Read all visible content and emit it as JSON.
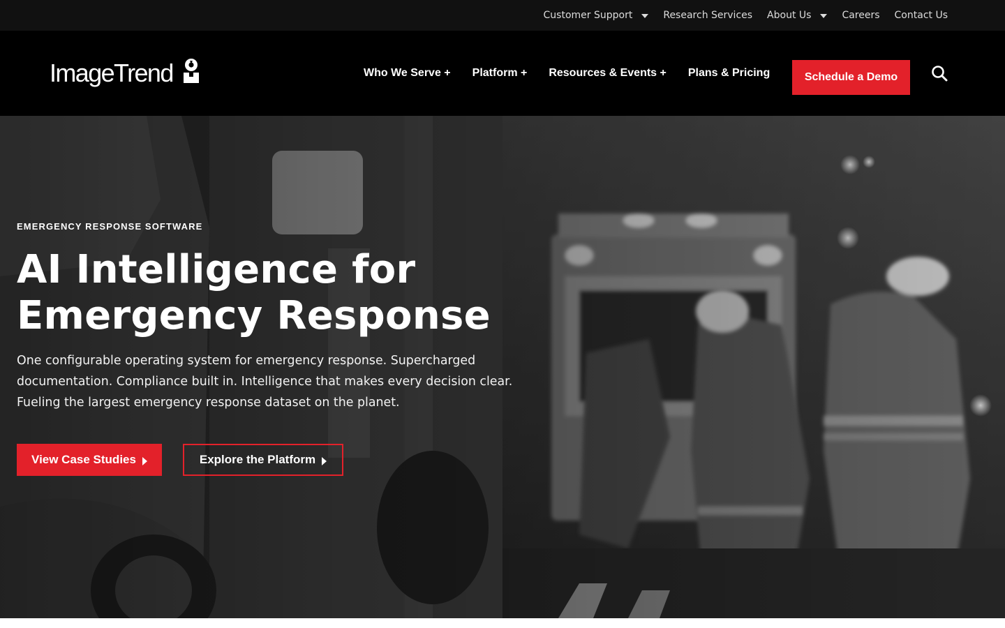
{
  "utility_nav": {
    "items": [
      {
        "label": "Customer Support",
        "has_dropdown": true
      },
      {
        "label": "Research Services",
        "has_dropdown": false
      },
      {
        "label": "About Us",
        "has_dropdown": true
      },
      {
        "label": "Careers",
        "has_dropdown": false
      },
      {
        "label": "Contact Us",
        "has_dropdown": false
      }
    ]
  },
  "header": {
    "logo_text": "ImageTrend",
    "nav": [
      {
        "label": "Who We Serve +"
      },
      {
        "label": "Platform +"
      },
      {
        "label": "Resources & Events +"
      },
      {
        "label": "Plans & Pricing"
      }
    ],
    "cta_label": "Schedule a Demo",
    "search_icon": "search-icon"
  },
  "hero": {
    "eyebrow": "EMERGENCY RESPONSE SOFTWARE",
    "headline": "AI Intelligence for Emergency Response",
    "subtext": "One configurable operating system for emergency response. Supercharged documentation. Compliance built in. Intelligence that makes every decision clear. Fueling the largest emergency response dataset on the planet.",
    "primary_button": "View Case Studies",
    "secondary_button": "Explore the Platform"
  },
  "colors": {
    "accent": "#e3212a",
    "utility_bg": "#111111",
    "nav_bg": "#000000",
    "text": "#ffffff"
  }
}
